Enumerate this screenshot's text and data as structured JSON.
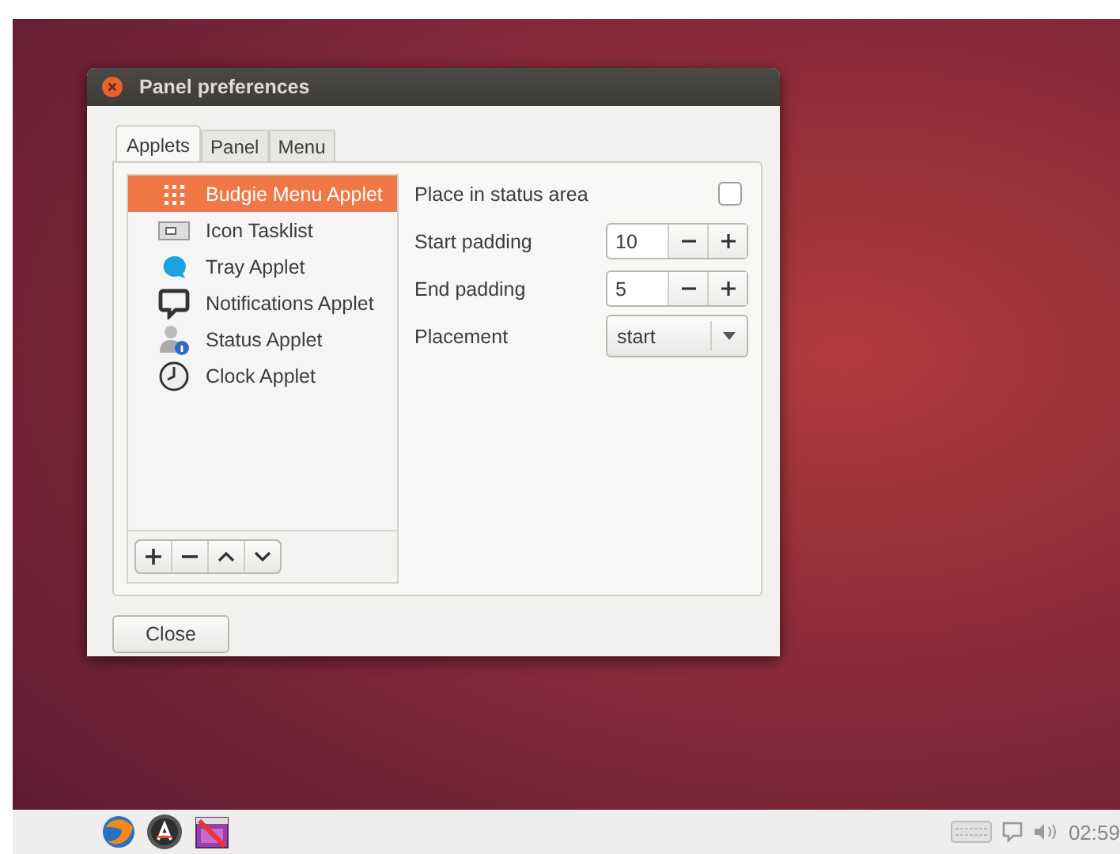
{
  "window": {
    "title": "Panel preferences"
  },
  "tabs": [
    {
      "label": "Applets",
      "selected": true
    },
    {
      "label": "Panel",
      "selected": false
    },
    {
      "label": "Menu",
      "selected": false
    }
  ],
  "applets": [
    {
      "name": "Budgie Menu Applet",
      "selected": true
    },
    {
      "name": "Icon Tasklist",
      "selected": false
    },
    {
      "name": "Tray Applet",
      "selected": false
    },
    {
      "name": "Notifications Applet",
      "selected": false
    },
    {
      "name": "Status Applet",
      "selected": false
    },
    {
      "name": "Clock Applet",
      "selected": false
    }
  ],
  "settings": [
    {
      "kind": "checkbox",
      "label": "Place in status area",
      "checked": false
    },
    {
      "kind": "spin",
      "label": "Start padding",
      "value": "10"
    },
    {
      "kind": "spin",
      "label": "End padding",
      "value": "5"
    },
    {
      "kind": "combo",
      "label": "Placement",
      "value": "start"
    }
  ],
  "close_button": "Close",
  "taskbar": {
    "clock": "02:59"
  }
}
